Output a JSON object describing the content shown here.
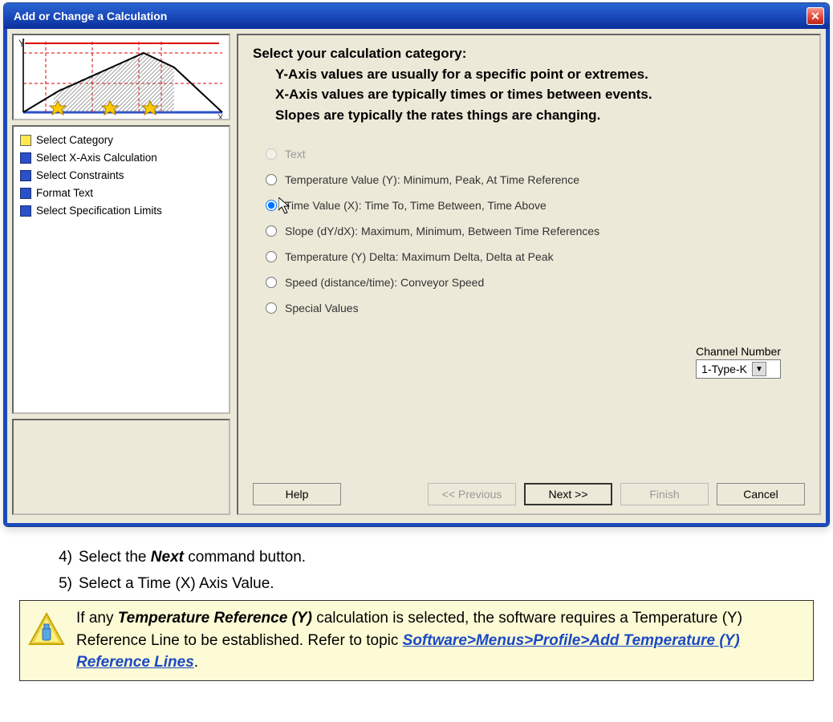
{
  "dialog": {
    "title": "Add or Change a Calculation",
    "steps": [
      {
        "color": "yellow",
        "label": "Select Category"
      },
      {
        "color": "blue",
        "label": "Select X-Axis Calculation"
      },
      {
        "color": "blue",
        "label": "Select Constraints"
      },
      {
        "color": "blue",
        "label": "Format Text"
      },
      {
        "color": "blue",
        "label": "Select Specification Limits"
      }
    ],
    "prompt_title": "Select your calculation category:",
    "prompt_lines": [
      "Y-Axis values are usually for a specific point or extremes.",
      "X-Axis values are typically times or times between events.",
      "Slopes are typically the rates things are changing."
    ],
    "options": [
      {
        "label": "Text",
        "disabled": true,
        "selected": false
      },
      {
        "label": "Temperature Value (Y):  Minimum, Peak, At Time Reference",
        "disabled": false,
        "selected": false
      },
      {
        "label": "Time Value (X):  Time To, Time Between, Time Above",
        "disabled": false,
        "selected": true
      },
      {
        "label": "Slope (dY/dX):  Maximum, Minimum, Between Time References",
        "disabled": false,
        "selected": false
      },
      {
        "label": "Temperature (Y) Delta:  Maximum Delta, Delta at Peak",
        "disabled": false,
        "selected": false
      },
      {
        "label": "Speed (distance/time): Conveyor Speed",
        "disabled": false,
        "selected": false
      },
      {
        "label": "Special  Values",
        "disabled": false,
        "selected": false
      }
    ],
    "channel_label": "Channel Number",
    "channel_value": "1-Type-K",
    "buttons": {
      "help": "Help",
      "previous": "<< Previous",
      "next": "Next >>",
      "finish": "Finish",
      "cancel": "Cancel"
    }
  },
  "instructions": {
    "items": [
      {
        "n": "4)",
        "pre": "Select the ",
        "bold": "Next",
        "post": " command button."
      },
      {
        "n": "5)",
        "pre": "Select a Time (X) Axis Value.",
        "bold": "",
        "post": ""
      }
    ]
  },
  "note": {
    "pre": "If any ",
    "bold1": "Temperature Reference (Y)",
    "mid": " calculation is selected, the software requires a Temperature (Y) Reference Line to be established. Refer to topic ",
    "link": "Software>Menus>Profile>Add Temperature (Y) Reference Lines",
    "post": "."
  }
}
